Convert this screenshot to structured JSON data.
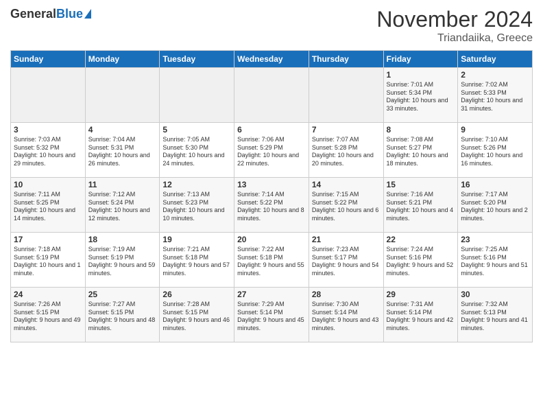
{
  "header": {
    "logo_general": "General",
    "logo_blue": "Blue",
    "title": "November 2024",
    "subtitle": "Triandaiika, Greece"
  },
  "days_of_week": [
    "Sunday",
    "Monday",
    "Tuesday",
    "Wednesday",
    "Thursday",
    "Friday",
    "Saturday"
  ],
  "weeks": [
    [
      {
        "day": "",
        "info": ""
      },
      {
        "day": "",
        "info": ""
      },
      {
        "day": "",
        "info": ""
      },
      {
        "day": "",
        "info": ""
      },
      {
        "day": "",
        "info": ""
      },
      {
        "day": "1",
        "info": "Sunrise: 7:01 AM\nSunset: 5:34 PM\nDaylight: 10 hours and 33 minutes."
      },
      {
        "day": "2",
        "info": "Sunrise: 7:02 AM\nSunset: 5:33 PM\nDaylight: 10 hours and 31 minutes."
      }
    ],
    [
      {
        "day": "3",
        "info": "Sunrise: 7:03 AM\nSunset: 5:32 PM\nDaylight: 10 hours and 29 minutes."
      },
      {
        "day": "4",
        "info": "Sunrise: 7:04 AM\nSunset: 5:31 PM\nDaylight: 10 hours and 26 minutes."
      },
      {
        "day": "5",
        "info": "Sunrise: 7:05 AM\nSunset: 5:30 PM\nDaylight: 10 hours and 24 minutes."
      },
      {
        "day": "6",
        "info": "Sunrise: 7:06 AM\nSunset: 5:29 PM\nDaylight: 10 hours and 22 minutes."
      },
      {
        "day": "7",
        "info": "Sunrise: 7:07 AM\nSunset: 5:28 PM\nDaylight: 10 hours and 20 minutes."
      },
      {
        "day": "8",
        "info": "Sunrise: 7:08 AM\nSunset: 5:27 PM\nDaylight: 10 hours and 18 minutes."
      },
      {
        "day": "9",
        "info": "Sunrise: 7:10 AM\nSunset: 5:26 PM\nDaylight: 10 hours and 16 minutes."
      }
    ],
    [
      {
        "day": "10",
        "info": "Sunrise: 7:11 AM\nSunset: 5:25 PM\nDaylight: 10 hours and 14 minutes."
      },
      {
        "day": "11",
        "info": "Sunrise: 7:12 AM\nSunset: 5:24 PM\nDaylight: 10 hours and 12 minutes."
      },
      {
        "day": "12",
        "info": "Sunrise: 7:13 AM\nSunset: 5:23 PM\nDaylight: 10 hours and 10 minutes."
      },
      {
        "day": "13",
        "info": "Sunrise: 7:14 AM\nSunset: 5:22 PM\nDaylight: 10 hours and 8 minutes."
      },
      {
        "day": "14",
        "info": "Sunrise: 7:15 AM\nSunset: 5:22 PM\nDaylight: 10 hours and 6 minutes."
      },
      {
        "day": "15",
        "info": "Sunrise: 7:16 AM\nSunset: 5:21 PM\nDaylight: 10 hours and 4 minutes."
      },
      {
        "day": "16",
        "info": "Sunrise: 7:17 AM\nSunset: 5:20 PM\nDaylight: 10 hours and 2 minutes."
      }
    ],
    [
      {
        "day": "17",
        "info": "Sunrise: 7:18 AM\nSunset: 5:19 PM\nDaylight: 10 hours and 1 minute."
      },
      {
        "day": "18",
        "info": "Sunrise: 7:19 AM\nSunset: 5:19 PM\nDaylight: 9 hours and 59 minutes."
      },
      {
        "day": "19",
        "info": "Sunrise: 7:21 AM\nSunset: 5:18 PM\nDaylight: 9 hours and 57 minutes."
      },
      {
        "day": "20",
        "info": "Sunrise: 7:22 AM\nSunset: 5:18 PM\nDaylight: 9 hours and 55 minutes."
      },
      {
        "day": "21",
        "info": "Sunrise: 7:23 AM\nSunset: 5:17 PM\nDaylight: 9 hours and 54 minutes."
      },
      {
        "day": "22",
        "info": "Sunrise: 7:24 AM\nSunset: 5:16 PM\nDaylight: 9 hours and 52 minutes."
      },
      {
        "day": "23",
        "info": "Sunrise: 7:25 AM\nSunset: 5:16 PM\nDaylight: 9 hours and 51 minutes."
      }
    ],
    [
      {
        "day": "24",
        "info": "Sunrise: 7:26 AM\nSunset: 5:15 PM\nDaylight: 9 hours and 49 minutes."
      },
      {
        "day": "25",
        "info": "Sunrise: 7:27 AM\nSunset: 5:15 PM\nDaylight: 9 hours and 48 minutes."
      },
      {
        "day": "26",
        "info": "Sunrise: 7:28 AM\nSunset: 5:15 PM\nDaylight: 9 hours and 46 minutes."
      },
      {
        "day": "27",
        "info": "Sunrise: 7:29 AM\nSunset: 5:14 PM\nDaylight: 9 hours and 45 minutes."
      },
      {
        "day": "28",
        "info": "Sunrise: 7:30 AM\nSunset: 5:14 PM\nDaylight: 9 hours and 43 minutes."
      },
      {
        "day": "29",
        "info": "Sunrise: 7:31 AM\nSunset: 5:14 PM\nDaylight: 9 hours and 42 minutes."
      },
      {
        "day": "30",
        "info": "Sunrise: 7:32 AM\nSunset: 5:13 PM\nDaylight: 9 hours and 41 minutes."
      }
    ]
  ]
}
